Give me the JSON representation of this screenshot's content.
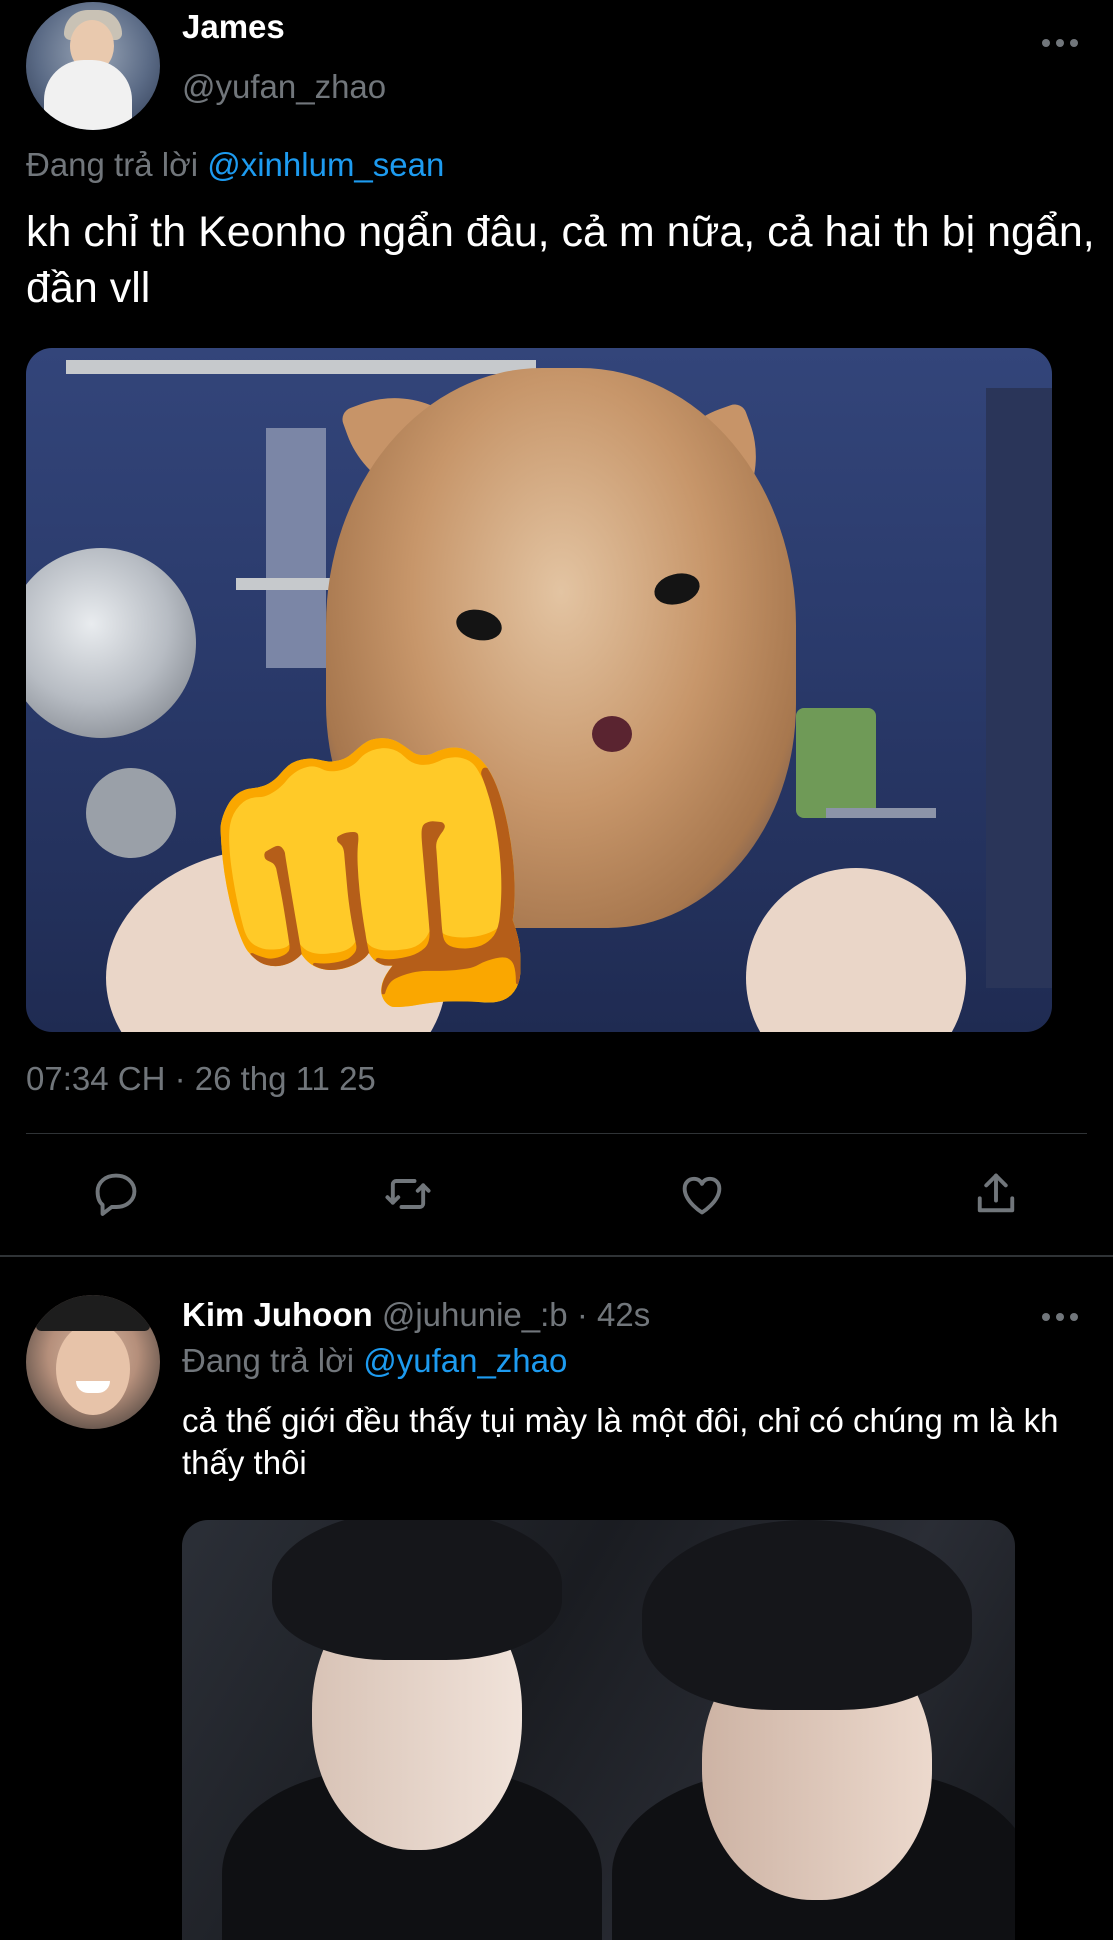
{
  "main_tweet": {
    "author_name": "James",
    "author_handle": "@yufan_zhao",
    "reply_prefix": "Đang trả lời",
    "reply_to": "@xinhlum_sean",
    "text": "kh chỉ th Keonho ngẩn đâu, cả m nữa, cả hai th bị ngẩn, đần vll",
    "timestamp": "07:34 CH · 26 thg 11 25",
    "media_emoji": "👊"
  },
  "actions": {
    "reply_icon": "reply-icon",
    "retweet_icon": "retweet-icon",
    "like_icon": "heart-icon",
    "share_icon": "share-icon"
  },
  "reply_tweet": {
    "author_name": "Kim Juhoon",
    "author_handle": "@juhunie_:b",
    "separator": "·",
    "age": "42s",
    "reply_prefix": "Đang trả lời",
    "reply_to": "@yufan_zhao",
    "text": "cả thế giới đều thấy tụi mày là một đôi, chỉ có chúng m là kh thấy thôi"
  },
  "colors": {
    "background": "#000000",
    "primary_text": "#ffffff",
    "secondary_text": "#71767b",
    "accent": "#1d9bf0",
    "divider": "#2f3336"
  }
}
